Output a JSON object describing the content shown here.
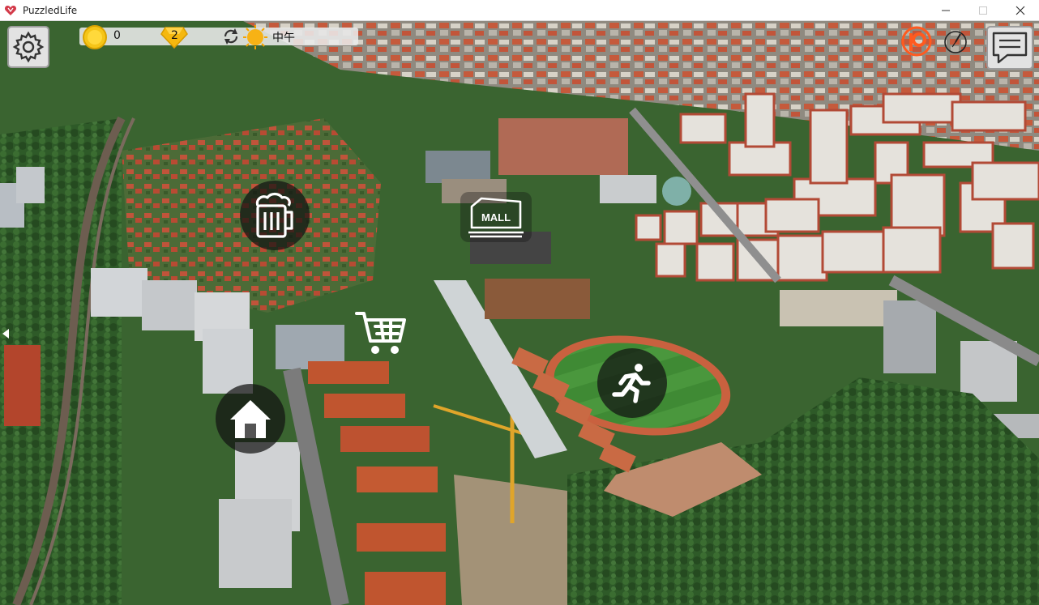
{
  "window": {
    "title": "PuzzledLife",
    "minimize_label": "minimize",
    "maximize_label": "maximize",
    "close_label": "close"
  },
  "hud": {
    "coins": "0",
    "gems": "2",
    "time_of_day": "中午",
    "icons": {
      "settings": "gear-icon",
      "coin": "coin-icon",
      "gem": "gem-icon",
      "refresh": "refresh-icon",
      "sun": "sun-icon",
      "patreon": "patreon-icon",
      "compass": "compass-icon",
      "chat": "chat-icon"
    }
  },
  "map": {
    "markers": [
      {
        "id": "bar",
        "icon": "beer-mug-icon"
      },
      {
        "id": "mall",
        "icon": "mall-icon",
        "label": "MALL"
      },
      {
        "id": "shop",
        "icon": "shopping-cart-icon"
      },
      {
        "id": "home",
        "icon": "house-icon"
      },
      {
        "id": "sport",
        "icon": "running-person-icon"
      }
    ]
  },
  "colors": {
    "accent_gold": "#f5c518",
    "patreon_orange": "#ff5a1f",
    "forest": "#2f5a2a",
    "roof_red": "#c2502e",
    "field_green": "#3f8a34",
    "clay": "#c9613f"
  }
}
